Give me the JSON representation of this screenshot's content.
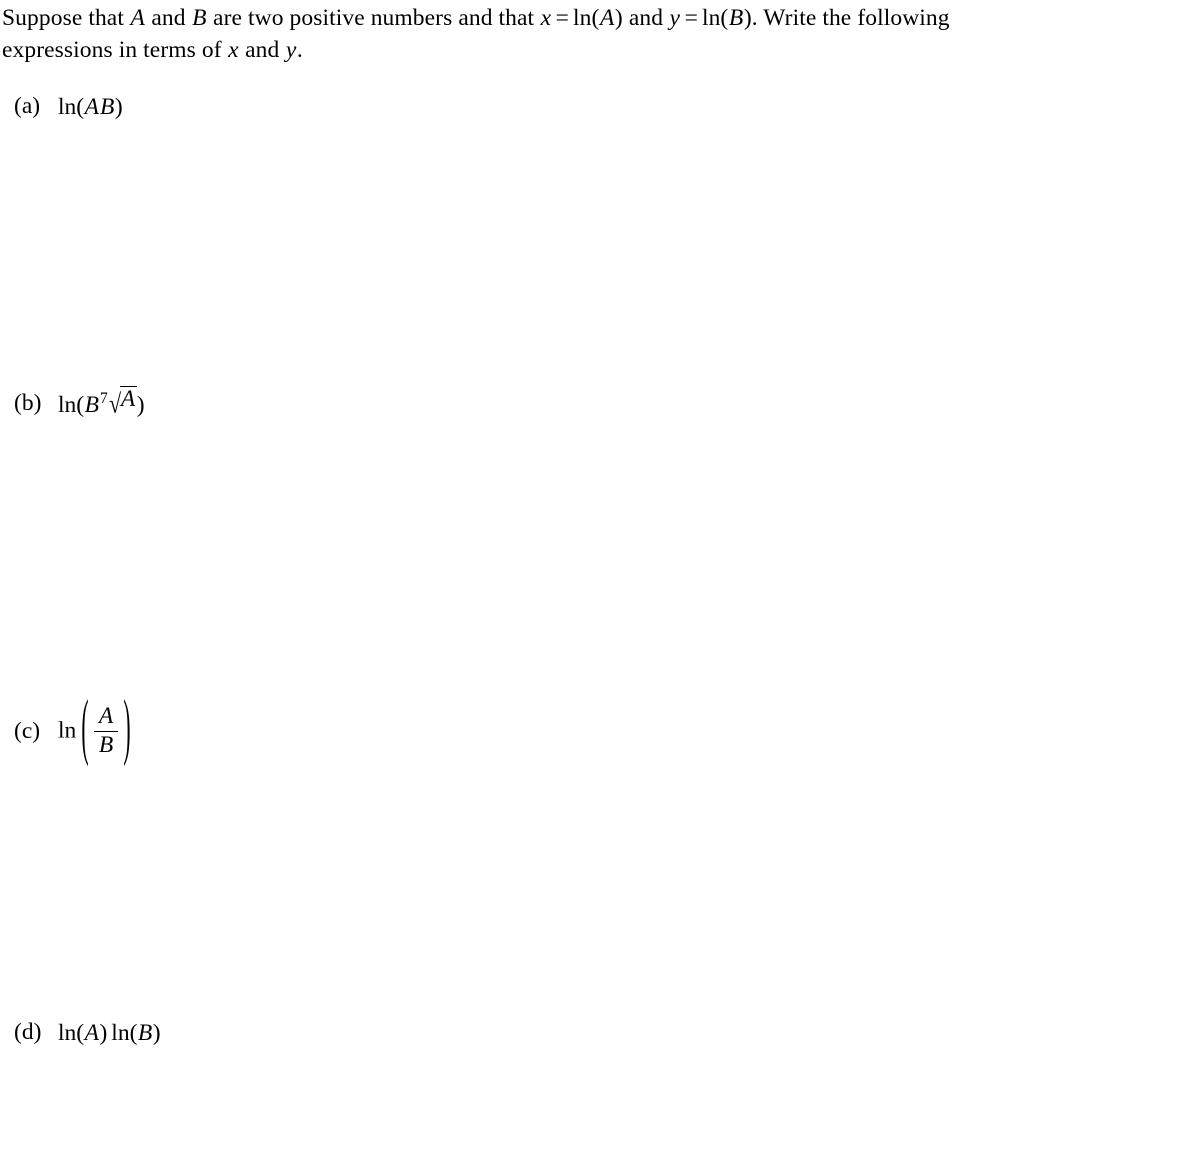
{
  "document": {
    "type": "math-worksheet-problem",
    "background_color": "#ffffff",
    "text_color": "#000000"
  },
  "prompt": {
    "line1_part1": "Suppose that ",
    "var_A": "A",
    "line1_part2": " and ",
    "var_B": "B",
    "line1_part3": " are two positive numbers and that ",
    "var_x": "x",
    "equals": "=",
    "ln": "ln",
    "paren_open": "(",
    "paren_close": ")",
    "line1_part4": " and ",
    "var_y": "y",
    "line1_part5": ".",
    "line1_part6": "  Write the following",
    "line2": "expressions in terms of ",
    "line2_mid": " and ",
    "line2_end": "."
  },
  "items": [
    {
      "label": "(a)",
      "expression_text": "ln(AB)",
      "ln": "ln",
      "paren_open": "(",
      "operand1": "A",
      "operand2": "B",
      "paren_close": ")"
    },
    {
      "label": "(b)",
      "expression_text": "ln(B^7 sqrt(A))",
      "ln": "ln",
      "paren_open": "(",
      "base": "B",
      "exponent": "7",
      "radical_sign": "√",
      "radicand": "A",
      "paren_close": ")"
    },
    {
      "label": "(c)",
      "expression_text": "ln(A/B)",
      "ln": "ln",
      "paren_open": "(",
      "numerator": "A",
      "denominator": "B",
      "paren_close": ")"
    },
    {
      "label": "(d)",
      "expression_text": "ln(A) ln(B)",
      "ln": "ln",
      "paren_open": "(",
      "operand1": "A",
      "paren_close": ")",
      "ln2": "ln",
      "paren_open2": "(",
      "operand2": "B",
      "paren_close2": ")"
    }
  ]
}
